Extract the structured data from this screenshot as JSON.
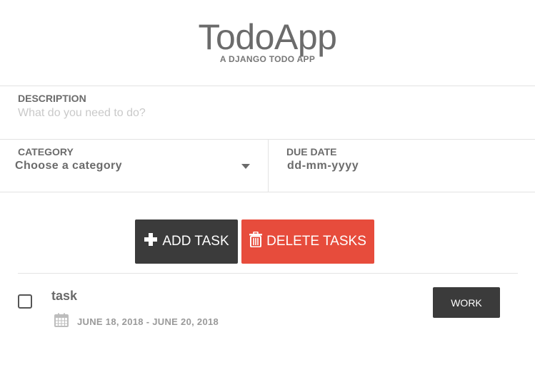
{
  "header": {
    "title": "TodoApp",
    "subtitle": "A DJANGO TODO APP"
  },
  "form": {
    "description": {
      "label": "DESCRIPTION",
      "value": "",
      "placeholder": "What do you need to do?"
    },
    "category": {
      "label": "CATEGORY",
      "selected": "Choose a category"
    },
    "due_date": {
      "label": "DUE DATE",
      "value": "dd-mm-yyyy"
    }
  },
  "actions": {
    "add_label": "ADD TASK",
    "add_icon": "plus-icon",
    "delete_label": "DELETE TASKS",
    "delete_icon": "trash-icon"
  },
  "tasks": [
    {
      "title": "task",
      "dates": "JUNE 18, 2018 - JUNE 20, 2018",
      "category": "WORK",
      "checked": false
    }
  ],
  "colors": {
    "dark_button": "#3b3b3b",
    "delete_button": "#e74c3c",
    "text": "#6b6b6b",
    "muted_text": "#9a9a9a",
    "divider": "#e3e3e3"
  }
}
